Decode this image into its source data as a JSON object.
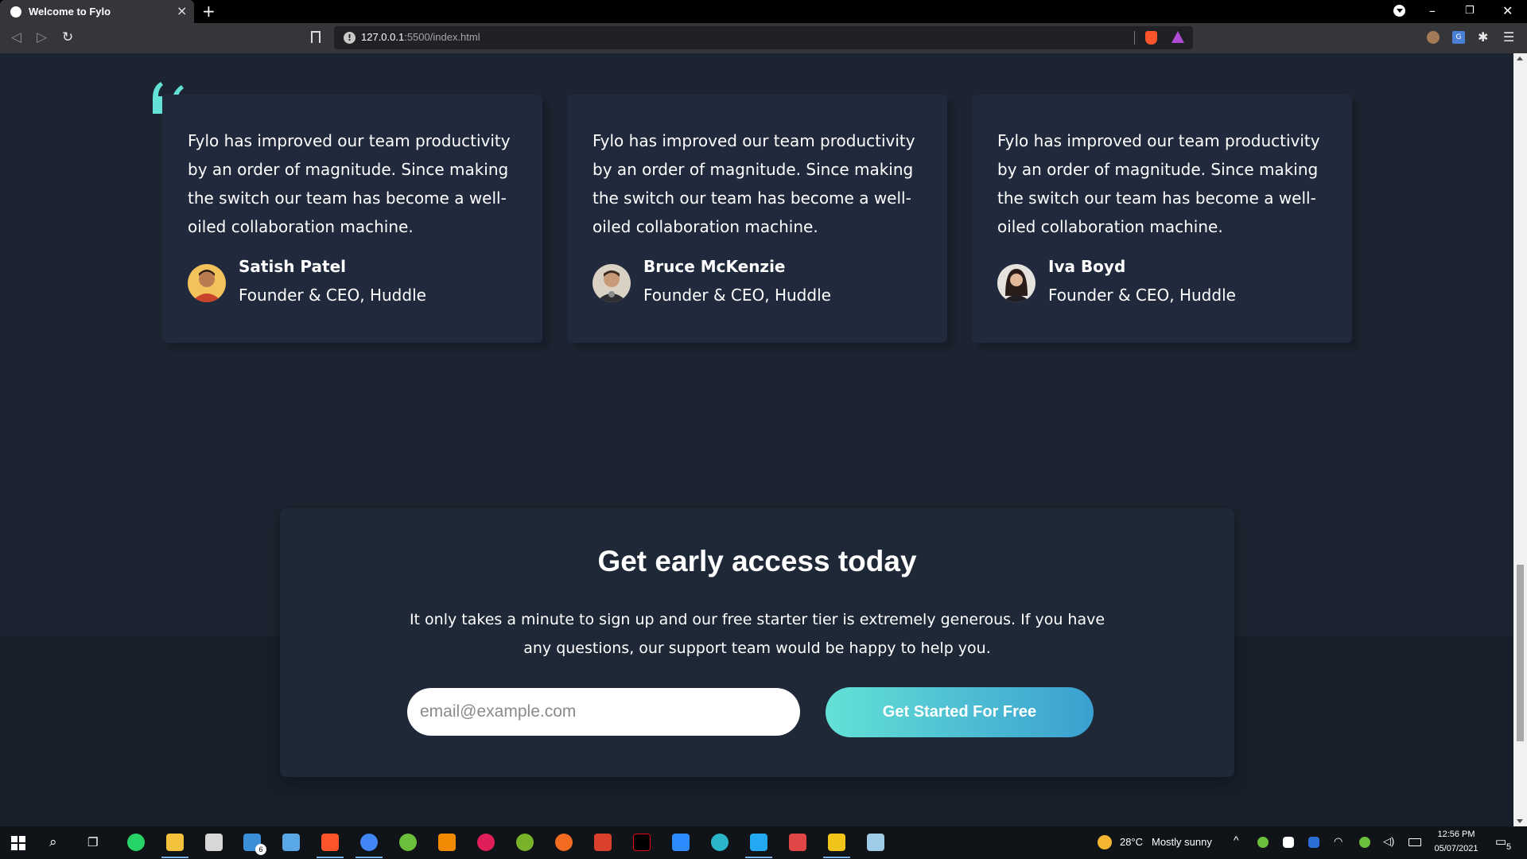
{
  "browser": {
    "tab_title": "Welcome to Fylo",
    "tab_close": "×",
    "new_tab": "+",
    "url_host": "127.0.0.1",
    "url_path": ":5500/index.html",
    "window_minimize": "–",
    "window_restore": "❐",
    "window_close": "✕"
  },
  "testimonials": [
    {
      "quote": "Fylo has improved our team productivity by an order of magnitude. Since making the switch our team has become a well-oiled collaboration machine.",
      "name": "Satish Patel",
      "role": "Founder & CEO, Huddle",
      "avatar_color": "#c9422b"
    },
    {
      "quote": "Fylo has improved our team productivity by an order of magnitude. Since making the switch our team has become a well-oiled collaboration machine.",
      "name": "Bruce McKenzie",
      "role": "Founder & CEO, Huddle",
      "avatar_color": "#5c4a3a"
    },
    {
      "quote": "Fylo has improved our team productivity by an order of magnitude. Since making the switch our team has become a well-oiled collaboration machine.",
      "name": "Iva Boyd",
      "role": "Founder & CEO, Huddle",
      "avatar_color": "#3a2f2f"
    }
  ],
  "cta": {
    "title": "Get early access today",
    "text": "It only takes a minute to sign up and our free starter tier is extremely generous. If you have any questions, our support team would be happy to help you.",
    "email_placeholder": "email@example.com",
    "button_label": "Get Started For Free"
  },
  "taskbar": {
    "mail_badge": "6",
    "weather_temp": "28°C",
    "weather_desc": "Mostly sunny",
    "time": "12:56 PM",
    "date": "05/07/2021",
    "notification_count": "5"
  },
  "colors": {
    "page_bg": "#1c2431",
    "card_bg": "#21293c",
    "footer_bg": "#181f2a",
    "accent_cyan": "#63e1d6",
    "accent_blue": "#3a9fd0"
  }
}
